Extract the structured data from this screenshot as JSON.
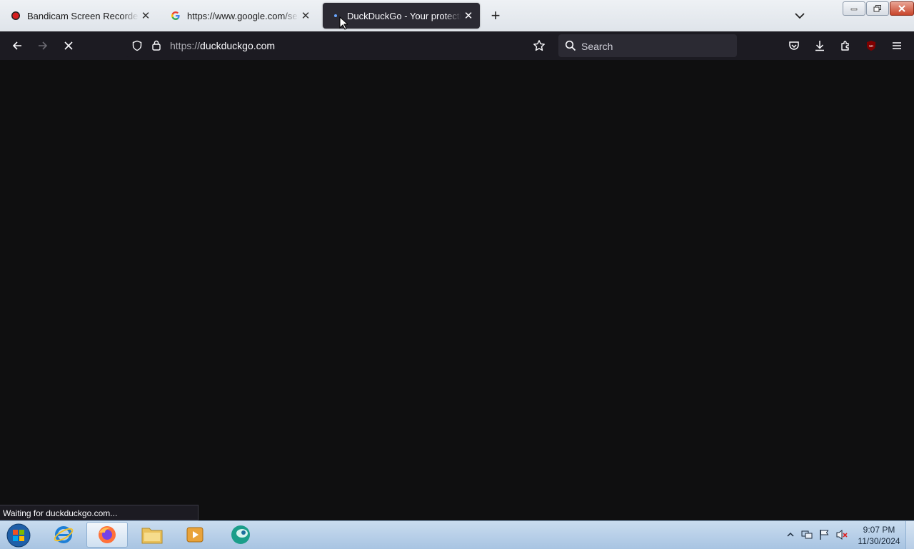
{
  "tabs": [
    {
      "title": "Bandicam Screen Recorder Download",
      "favicon": "bandicam-icon",
      "active": false
    },
    {
      "title": "https://www.google.com/search",
      "favicon": "google-icon",
      "active": false
    },
    {
      "title": "DuckDuckGo - Your protection",
      "favicon": "loading-dot-icon",
      "active": true
    }
  ],
  "toolbar": {
    "url_prefix": "https://",
    "url_host": "duckduckgo.com",
    "search_placeholder": "Search"
  },
  "status": {
    "text": "Waiting for duckduckgo.com..."
  },
  "taskbar": {
    "time": "9:07 PM",
    "date": "11/30/2024"
  },
  "colors": {
    "content_bg": "#0f0f10",
    "toolbar_bg": "#1c1b22",
    "active_tab_bg": "#2b2a33"
  }
}
